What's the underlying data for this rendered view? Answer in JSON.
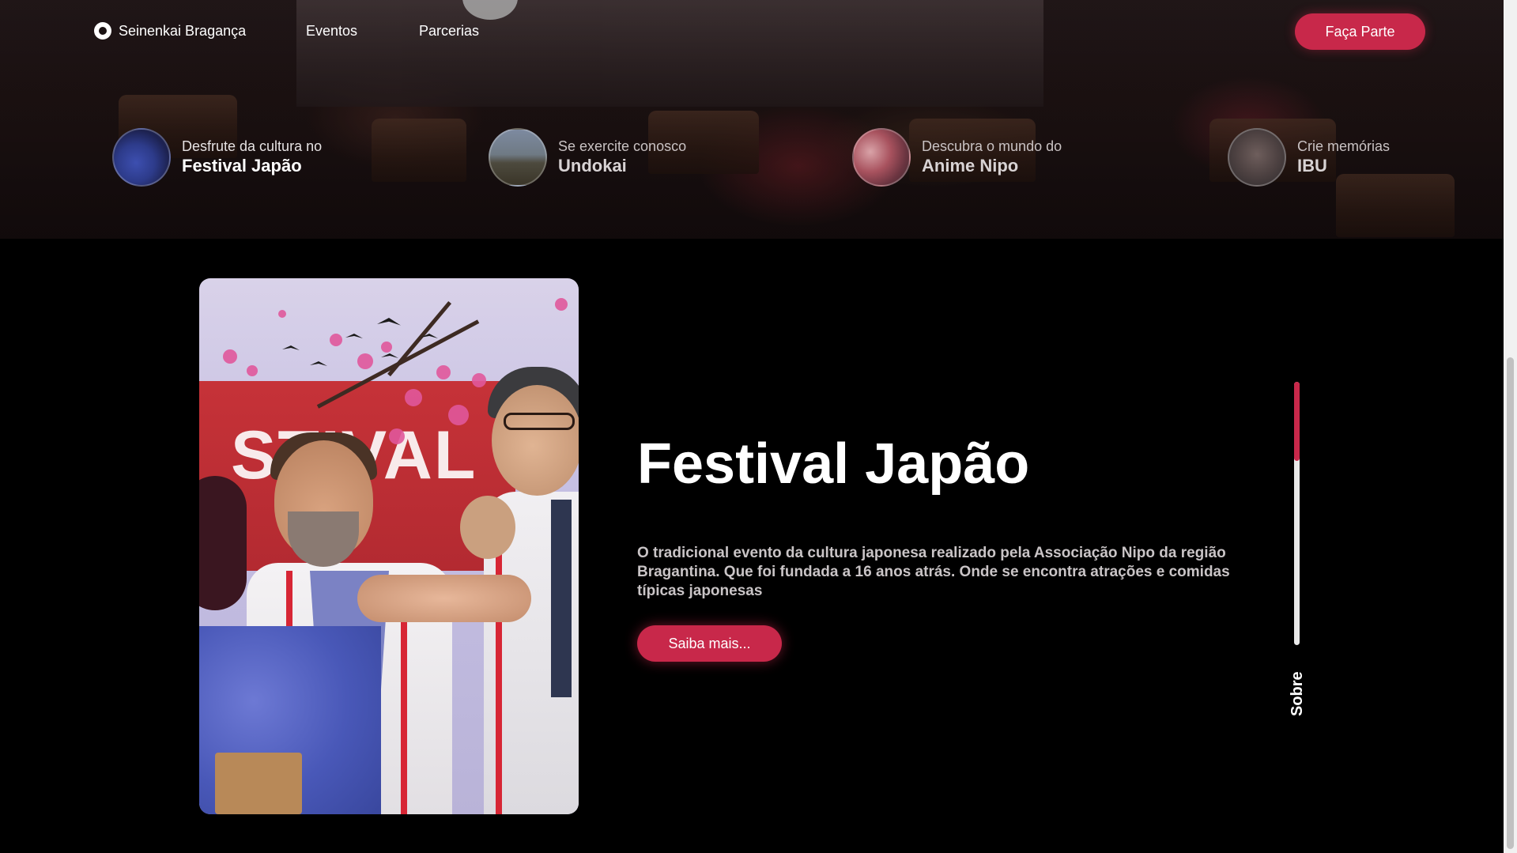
{
  "brand": {
    "name": "Seinenkai Bragança"
  },
  "nav": {
    "links": [
      "Eventos",
      "Parcerias"
    ],
    "cta": "Faça Parte"
  },
  "carousel": [
    {
      "small": "Desfrute da cultura no",
      "big": "Festival Japão",
      "active": true
    },
    {
      "small": "Se exercite conosco",
      "big": "Undokai",
      "active": false
    },
    {
      "small": "Descubra o mundo do",
      "big": "Anime Nipo",
      "active": false
    },
    {
      "small": "Crie memórias",
      "big": "IBU",
      "active": false
    }
  ],
  "feature": {
    "title": "Festival Japão",
    "description": "O tradicional evento da cultura japonesa realizado pela Associação Nipo da região Bragantina. Que foi fundada a 16 anos atrás. Onde se encontra atrações e comidas típicas japonesas",
    "button": "Saiba mais..."
  },
  "section_indicator": {
    "label": "Sobre",
    "progress": 0.3
  },
  "colors": {
    "accent": "#c8284a",
    "background": "#000000"
  },
  "icons": {
    "logo": "chat-bubble-logo-icon"
  }
}
